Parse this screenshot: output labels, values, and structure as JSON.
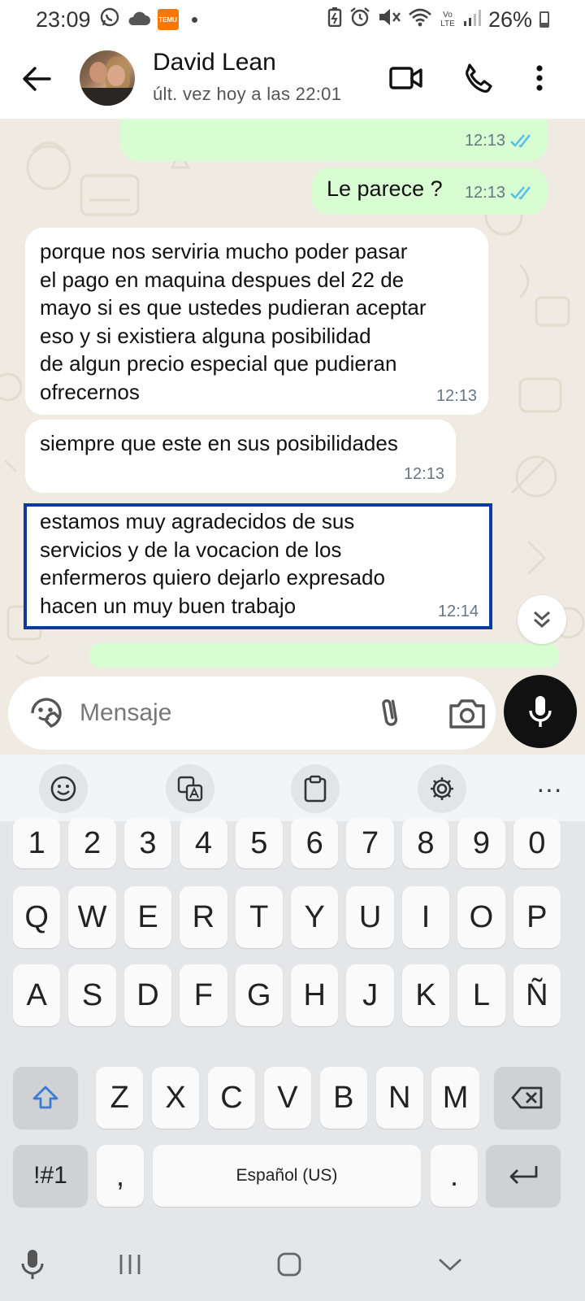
{
  "status_bar": {
    "time": "23:09",
    "battery": "26%",
    "icons_left": [
      "whatsapp-icon",
      "cloud-icon",
      "temu-icon",
      "dot-icon"
    ],
    "temu_text": "TEMU",
    "icons_right": [
      "battery-saver-icon",
      "alarm-icon",
      "mute-icon",
      "wifi-icon",
      "volte-icon",
      "signal-icon",
      "battery-icon"
    ],
    "volte_text": "Vo LTE"
  },
  "header": {
    "contact_name": "David Lean",
    "last_seen": "últ. vez hoy a las 22:01",
    "icons": [
      "back-arrow-icon",
      "video-call-icon",
      "phone-icon",
      "more-vert-icon"
    ]
  },
  "messages": [
    {
      "direction": "out",
      "text": "",
      "time": "12:13",
      "ticks": "read",
      "partial": "cut off at top"
    },
    {
      "direction": "out",
      "text": "Le parece ?",
      "time": "12:13",
      "ticks": "read"
    },
    {
      "direction": "in",
      "lines": [
        "porque nos serviria mucho poder pasar",
        "el pago en maquina despues del 22 de",
        "mayo si es que ustedes pudieran aceptar",
        "eso y si existiera alguna posibilidad",
        "de algun precio especial que pudieran",
        "ofrecernos"
      ],
      "time": "12:13"
    },
    {
      "direction": "in",
      "lines": [
        "siempre que este en sus posibilidades"
      ],
      "time": "12:13"
    },
    {
      "direction": "in",
      "lines": [
        "estamos muy agradecidos de sus",
        "servicios y de la vocacion de los",
        "enfermeros quiero dejarlo expresado",
        "hacen un muy buen trabajo"
      ],
      "time": "12:14",
      "selected": true
    }
  ],
  "input": {
    "placeholder": "Mensaje",
    "icons": [
      "sticker-icon",
      "attach-icon",
      "camera-icon",
      "mic-icon"
    ]
  },
  "keyboard": {
    "toolbar": [
      "emoji-icon",
      "translate-icon",
      "clipboard-icon",
      "settings-icon",
      "more-horiz-icon"
    ],
    "more_label": "···",
    "row_numbers": [
      "1",
      "2",
      "3",
      "4",
      "5",
      "6",
      "7",
      "8",
      "9",
      "0"
    ],
    "row1": [
      "Q",
      "W",
      "E",
      "R",
      "T",
      "Y",
      "U",
      "I",
      "O",
      "P"
    ],
    "row2": [
      "A",
      "S",
      "D",
      "F",
      "G",
      "H",
      "J",
      "K",
      "L",
      "Ñ"
    ],
    "row3": [
      "Z",
      "X",
      "C",
      "V",
      "B",
      "N",
      "M"
    ],
    "symbols_key": "!#1",
    "comma_key": ",",
    "space_label": "Español (US)",
    "period_key": "."
  },
  "nav_bar": {
    "icons": [
      "keyboard-mic-icon",
      "recent-apps-icon",
      "home-icon",
      "hide-keyboard-icon"
    ]
  },
  "colors": {
    "outgoing_bubble": "#d9fdd3",
    "incoming_bubble": "#ffffff",
    "chat_background": "#f0ebe2",
    "read_ticks": "#53bdeb",
    "selection_outline": "#0b3b9c",
    "mic_button": "#111111"
  }
}
